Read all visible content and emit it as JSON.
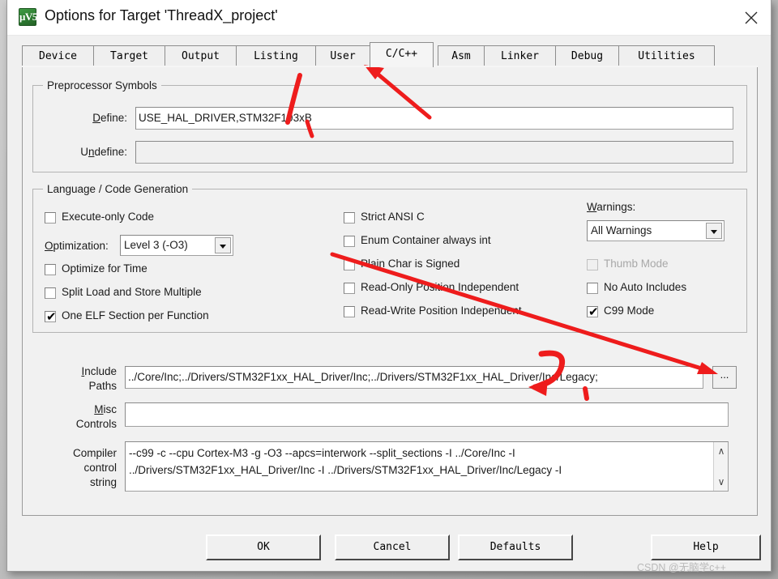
{
  "window": {
    "title": "Options for Target 'ThreadX_project'",
    "icon_name": "uvision-logo-icon",
    "icon_glyph": "μV5",
    "close_label": "✕"
  },
  "tabs": [
    {
      "label": "Device",
      "active": false
    },
    {
      "label": "Target",
      "active": false
    },
    {
      "label": "Output",
      "active": false
    },
    {
      "label": "Listing",
      "active": false
    },
    {
      "label": "User",
      "active": false
    },
    {
      "label": "C/C++",
      "active": true
    },
    {
      "label": "Asm",
      "active": false
    },
    {
      "label": "Linker",
      "active": false
    },
    {
      "label": "Debug",
      "active": false
    },
    {
      "label": "Utilities",
      "active": false
    }
  ],
  "preprocessor": {
    "group_title": "Preprocessor Symbols",
    "define_label": "Define:",
    "define_value": "USE_HAL_DRIVER,STM32F103xB",
    "undefine_label": "Undefine:",
    "undefine_value": ""
  },
  "language": {
    "group_title": "Language / Code Generation",
    "optimization_label": "Optimization:",
    "optimization_value": "Level 3 (-O3)",
    "warnings_label": "Warnings:",
    "warnings_value": "All Warnings",
    "column_left": [
      {
        "label": "Execute-only Code",
        "checked": false,
        "enabled": true
      },
      {
        "label": "Optimize for Time",
        "checked": false,
        "enabled": true
      },
      {
        "label": "Split Load and Store Multiple",
        "checked": false,
        "enabled": true
      },
      {
        "label": "One ELF Section per Function",
        "checked": true,
        "enabled": true
      }
    ],
    "column_middle": [
      {
        "label": "Strict ANSI C",
        "checked": false,
        "enabled": true
      },
      {
        "label": "Enum Container always int",
        "checked": false,
        "enabled": true
      },
      {
        "label": "Plain Char is Signed",
        "checked": false,
        "enabled": true
      },
      {
        "label": "Read-Only Position Independent",
        "checked": false,
        "enabled": true
      },
      {
        "label": "Read-Write Position Independent",
        "checked": false,
        "enabled": true
      }
    ],
    "column_right": [
      {
        "label": "Thumb Mode",
        "checked": false,
        "enabled": false
      },
      {
        "label": "No Auto Includes",
        "checked": false,
        "enabled": true
      },
      {
        "label": "C99 Mode",
        "checked": true,
        "enabled": true
      }
    ]
  },
  "paths": {
    "include_label_line1": "Include",
    "include_label_line2": "Paths",
    "include_value": "../Core/Inc;../Drivers/STM32F1xx_HAL_Driver/Inc;../Drivers/STM32F1xx_HAL_Driver/Inc/Legacy;",
    "misc_label_line1": "Misc",
    "misc_label_line2": "Controls",
    "misc_value": "",
    "browse_label": "...",
    "compiler_label_line1": "Compiler",
    "compiler_label_line2": "control",
    "compiler_label_line3": "string",
    "compiler_line1": "--c99 -c --cpu Cortex-M3 -g -O3 --apcs=interwork --split_sections -I ../Core/Inc -I",
    "compiler_line2": "../Drivers/STM32F1xx_HAL_Driver/Inc -I ../Drivers/STM32F1xx_HAL_Driver/Inc/Legacy -I",
    "scroll_up": "∧",
    "scroll_down": "∨"
  },
  "buttons": {
    "ok": "OK",
    "cancel": "Cancel",
    "defaults": "Defaults",
    "help": "Help"
  },
  "watermark": "CSDN @无脑学c++",
  "annotation_color": "#ee1c1c"
}
